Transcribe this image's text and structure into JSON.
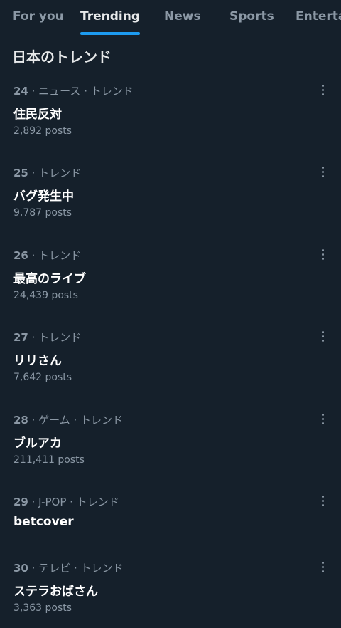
{
  "tabs": [
    {
      "label": "For you"
    },
    {
      "label": "Trending"
    },
    {
      "label": "News"
    },
    {
      "label": "Sports"
    },
    {
      "label": "Entertainment"
    }
  ],
  "active_tab": "Trending",
  "section_title": "日本のトレンド",
  "trends": [
    {
      "rank": "24",
      "category": " · ニュース · トレンド",
      "name": "住民反対",
      "posts": "2,892 posts"
    },
    {
      "rank": "25",
      "category": " · トレンド",
      "name": "バグ発生中",
      "posts": "9,787 posts"
    },
    {
      "rank": "26",
      "category": " · トレンド",
      "name": "最高のライブ",
      "posts": "24,439 posts"
    },
    {
      "rank": "27",
      "category": " · トレンド",
      "name": "リリさん",
      "posts": "7,642 posts"
    },
    {
      "rank": "28",
      "category": " · ゲーム · トレンド",
      "name": "ブルアカ",
      "posts": "211,411 posts"
    },
    {
      "rank": "29",
      "category": " · J-POP · トレンド",
      "name": "betcover",
      "posts": ""
    },
    {
      "rank": "30",
      "category": " · テレビ · トレンド",
      "name": "ステラおばさん",
      "posts": "3,363 posts"
    }
  ],
  "icons": {
    "more": "more-horizontal-icon"
  },
  "colors": {
    "background": "#15202b",
    "accent": "#1d9bf0",
    "muted": "#8b98a5",
    "text": "#e7e9ea"
  }
}
